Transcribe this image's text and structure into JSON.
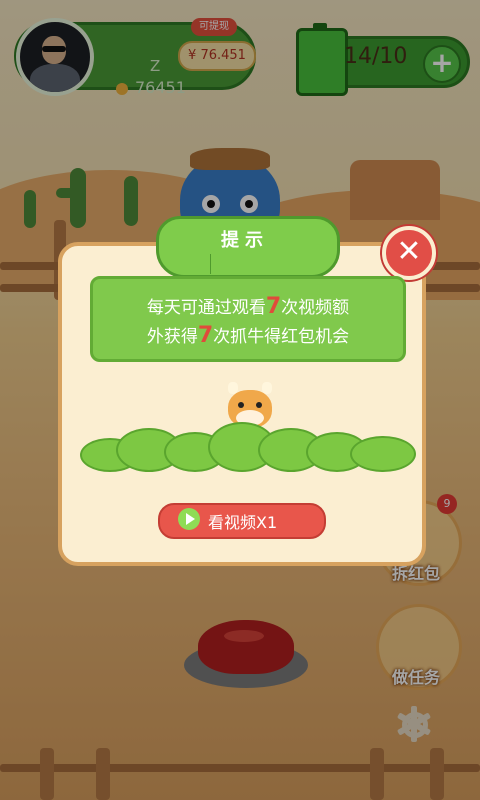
{
  "header": {
    "profile": {
      "name": "Z",
      "coins": "76451",
      "cash_tag": "可提现",
      "cash_value": "¥ 76.451"
    },
    "energy": {
      "count": "14/10",
      "add_symbol": "+"
    }
  },
  "dialog": {
    "title": "提示",
    "close_symbol": "✕",
    "message": {
      "line1_before": "每天可通过观看",
      "line1_number": "7",
      "line1_after": "次视频额",
      "line2_before": "外获得",
      "line2_number": "7",
      "line2_after": "次抓牛得红包机会"
    },
    "watch_button_label": "看视频X1"
  },
  "side": {
    "red_packet": {
      "label": "拆红包",
      "badge": "9"
    },
    "tasks": {
      "label": "做任务"
    }
  },
  "icons": {
    "settings": "gear-icon",
    "play": "play-icon",
    "close": "close-icon",
    "add": "plus-icon",
    "battery": "battery-icon"
  },
  "colors": {
    "accent_green": "#7fcc4b",
    "close_red": "#e14e47",
    "button_red": "#e8564b",
    "highlight_number": "#e04b3b"
  }
}
